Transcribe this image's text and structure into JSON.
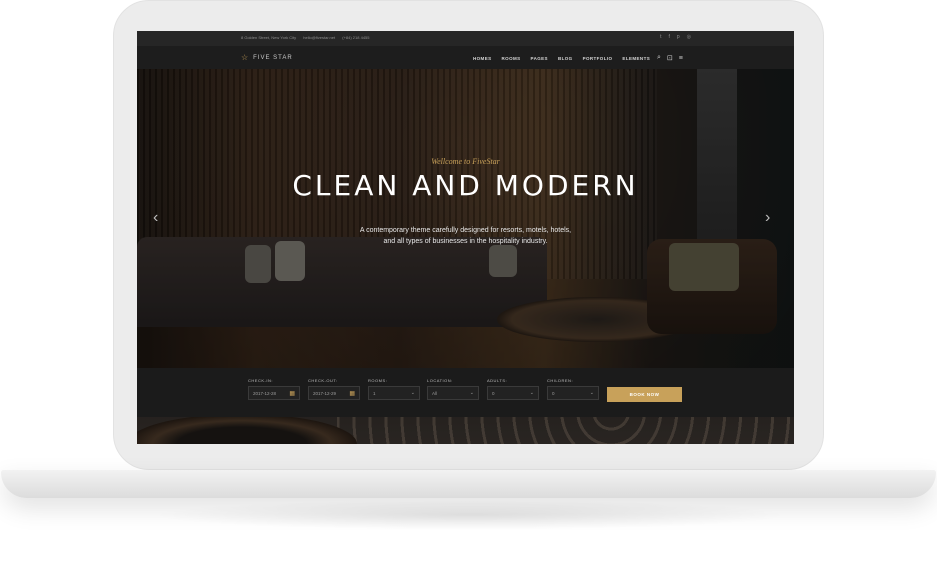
{
  "topbar": {
    "address": "8 Golden Street, New York City",
    "email": "hello@fivestar.net",
    "phone": "(+84) 218 4455",
    "social_icons": [
      "twitter-icon",
      "facebook-icon",
      "pinterest-icon",
      "instagram-icon"
    ]
  },
  "nav": {
    "logo_text": "FIVE STAR",
    "menu": [
      "HOMES",
      "ROOMS",
      "PAGES",
      "BLOG",
      "PORTFOLIO",
      "ELEMENTS"
    ],
    "icons": [
      "search-icon",
      "cart-icon",
      "menu-icon"
    ]
  },
  "hero": {
    "welcome": "Wellcome to FiveStar",
    "headline": "CLEAN AND MODERN",
    "desc_line1": "A contemporary theme carefully designed for resorts, motels, hotels,",
    "desc_line2": "and all types of businesses in the hospitality industry.",
    "prev_arrow": "‹",
    "next_arrow": "›"
  },
  "booking": {
    "checkin": {
      "label": "CHECK-IN:",
      "value": "2017-12-28"
    },
    "checkout": {
      "label": "CHECK-OUT:",
      "value": "2017-12-29"
    },
    "rooms": {
      "label": "ROOMS:",
      "value": "1"
    },
    "location": {
      "label": "LOCATION:",
      "value": "All"
    },
    "adults": {
      "label": "ADULTS:",
      "value": "0"
    },
    "children": {
      "label": "CHILDREN:",
      "value": "0"
    },
    "book_button": "BOOK NOW"
  },
  "colors": {
    "accent": "#c8a15a",
    "dark": "#1b1b1b"
  }
}
